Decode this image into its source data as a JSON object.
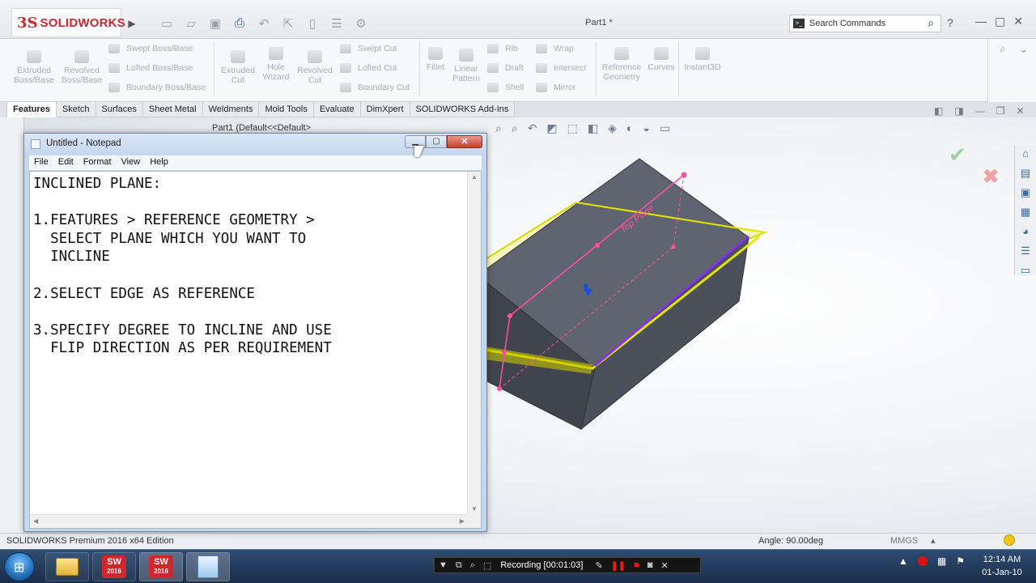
{
  "solidworks": {
    "logo_ds": "3S",
    "logo_name": "SOLIDWORKS",
    "document_title": "Part1 *",
    "search_placeholder": "Search Commands",
    "help_icon": "?",
    "command_manager": {
      "extruded_boss": "Extruded Boss/Base",
      "revolved_boss": "Revolved Boss/Base",
      "swept_boss": "Swept Boss/Base",
      "lofted_boss": "Lofted Boss/Base",
      "boundary_boss": "Boundary Boss/Base",
      "extruded_cut": "Extruded Cut",
      "hole_wizard": "Hole Wizard",
      "revolved_cut": "Revolved Cut",
      "swept_cut": "Swept Cut",
      "lofted_cut": "Lofted Cut",
      "boundary_cut": "Boundary Cut",
      "fillet": "Fillet",
      "linear_pattern": "Linear Pattern",
      "rib": "Rib",
      "draft": "Draft",
      "shell": "Shell",
      "wrap": "Wrap",
      "intersect": "Intersect",
      "mirror": "Mirror",
      "reference_geometry": "Reference Geometry",
      "curves": "Curves",
      "instant3d": "Instant3D"
    },
    "tabs": [
      "Features",
      "Sketch",
      "Surfaces",
      "Sheet Metal",
      "Weldments",
      "Mold Tools",
      "Evaluate",
      "DimXpert",
      "SOLIDWORKS Add-Ins"
    ],
    "active_tab": "Features",
    "tree_path": "Part1  (Default<<Default>",
    "plane_label": "Top Plane",
    "status": {
      "edition": "SOLIDWORKS Premium 2016 x64 Edition",
      "angle": "Angle: 90.00deg",
      "units": "MMGS"
    }
  },
  "notepad": {
    "title": "Untitled - Notepad",
    "menu": [
      "File",
      "Edit",
      "Format",
      "View",
      "Help"
    ],
    "content": "INCLINED PLANE:\n\n1.FEATURES > REFERENCE GEOMETRY >\n  SELECT PLANE WHICH YOU WANT TO\n  INCLINE\n\n2.SELECT EDGE AS REFERENCE\n\n3.SPECIFY DEGREE TO INCLINE AND USE\n  FLIP DIRECTION AS PER REQUIREMENT"
  },
  "taskbar": {
    "sw_year_1": "2016",
    "sw_year_2": "2016",
    "sw_label": "SW",
    "recording_label": "Recording [00:01:03]",
    "clock_time": "12:14 AM",
    "clock_date": "01-Jan-10"
  },
  "colors": {
    "sw_red": "#d0262d",
    "plane_yellow": "#e6e600",
    "sketch_pink": "#ff4fa3",
    "edge_purple": "#8b2cff",
    "body_gray": "#5f6570",
    "taskbar_blue": "#1f3553"
  }
}
